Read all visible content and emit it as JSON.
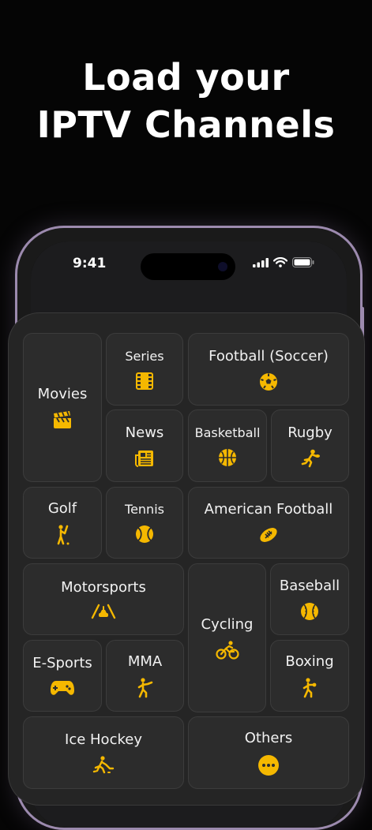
{
  "headline": {
    "line1": "Load your",
    "line2": "IPTV Channels"
  },
  "status_bar": {
    "time": "9:41"
  },
  "accent_color": "#F5B800",
  "categories": [
    {
      "label": "Movies",
      "icon": "clapperboard-icon"
    },
    {
      "label": "Series",
      "icon": "film-strip-icon"
    },
    {
      "label": "Football (Soccer)",
      "icon": "soccer-ball-icon"
    },
    {
      "label": "News",
      "icon": "newspaper-icon"
    },
    {
      "label": "Basketball",
      "icon": "basketball-icon"
    },
    {
      "label": "Rugby",
      "icon": "rugby-player-icon"
    },
    {
      "label": "Golf",
      "icon": "golfer-icon"
    },
    {
      "label": "Tennis",
      "icon": "tennis-ball-icon"
    },
    {
      "label": "American Football",
      "icon": "american-football-icon"
    },
    {
      "label": "Motorsports",
      "icon": "race-track-icon"
    },
    {
      "label": "Cycling",
      "icon": "bicycle-icon"
    },
    {
      "label": "Baseball",
      "icon": "baseball-icon"
    },
    {
      "label": "E-Sports",
      "icon": "gamepad-icon"
    },
    {
      "label": "MMA",
      "icon": "fighter-icon"
    },
    {
      "label": "Boxing",
      "icon": "boxer-icon"
    },
    {
      "label": "Ice Hockey",
      "icon": "hockey-player-icon"
    },
    {
      "label": "Others",
      "icon": "more-dots-icon"
    }
  ]
}
